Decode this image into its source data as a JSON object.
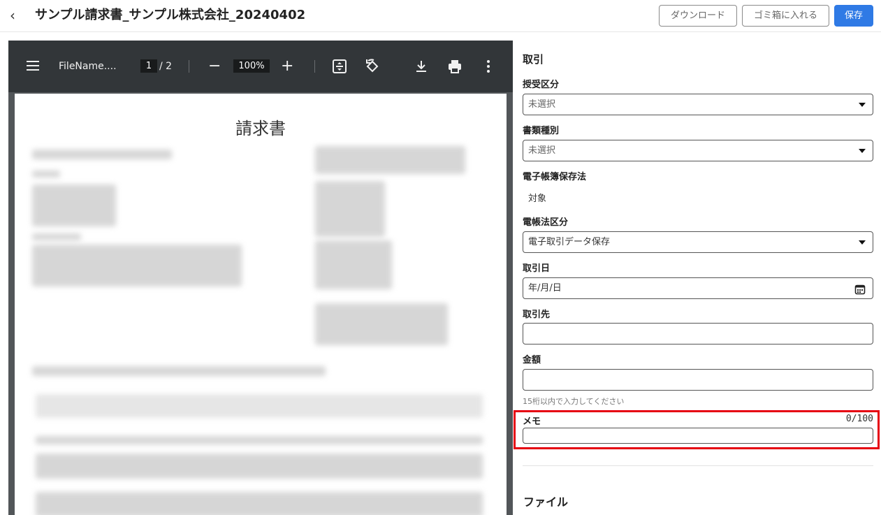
{
  "header": {
    "back_glyph": "‹",
    "title": "サンプル請求書_サンプル株式会社_20240402",
    "download_label": "ダウンロード",
    "trash_label": "ゴミ箱に入れる",
    "save_label": "保存"
  },
  "viewer": {
    "filename": "FileName....",
    "current_page": "1",
    "total_pages": "/ 2",
    "zoom": "100%",
    "zoom_minus": "−",
    "zoom_plus": "+",
    "document_title": "請求書"
  },
  "form": {
    "section_title": "取引",
    "receive_type": {
      "label": "授受区分",
      "value": "未選択"
    },
    "doc_type": {
      "label": "書類種別",
      "value": "未選択"
    },
    "ebook_law": {
      "label": "電子帳簿保存法",
      "value": "対象"
    },
    "ebook_category": {
      "label": "電帳法区分",
      "value": "電子取引データ保存"
    },
    "date": {
      "label": "取引日",
      "placeholder": "年/月/日"
    },
    "partner": {
      "label": "取引先",
      "value": ""
    },
    "amount": {
      "label": "金額",
      "value": "",
      "hint": "15桁以内で入力してください"
    },
    "memo": {
      "label": "メモ",
      "counter": "0/100",
      "value": ""
    },
    "file_section": "ファイル"
  },
  "colors": {
    "primary": "#2f7ae5",
    "highlight": "#e60012",
    "toolbar": "#323639"
  }
}
